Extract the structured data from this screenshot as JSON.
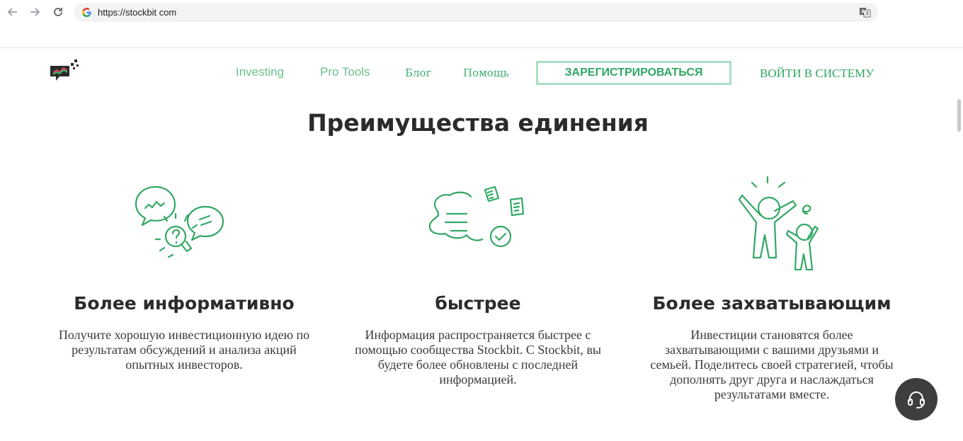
{
  "browser": {
    "url": "https://stockbit com"
  },
  "header": {
    "menu": [
      "Investing",
      "Pro Tools",
      "Блог",
      "Помощь"
    ],
    "register_label": "ЗАРЕГИСТРИРОВАТЬСЯ",
    "login_label": "ВОЙТИ В СИСТЕМУ"
  },
  "main": {
    "title": "Преимущества единения",
    "features": [
      {
        "icon": "chat-lightbulb",
        "title": "Более информативно",
        "text": "Получите хорошую инвестиционную идею по результатам обсуждений и анализа акций опытных инвесторов."
      },
      {
        "icon": "speed-notes",
        "title": "быстрее",
        "text": "Информация распространяется быстрее с помощью сообщества Stockbit. С Stockbit, вы будете более обновлены с последней информацией."
      },
      {
        "icon": "cheering-people",
        "title": "Более захватывающим",
        "text": "Инвестиции становятся более захватывающими с вашими друзьями и семьей. Поделитесь своей стратегией, чтобы дополнять друг друга и наслаждаться результатами вместе."
      }
    ]
  },
  "colors": {
    "brand_green": "#2fa765",
    "light_green": "#6abf8e",
    "border_green": "#a8e0c4",
    "support_bg": "#3e3e3e"
  }
}
